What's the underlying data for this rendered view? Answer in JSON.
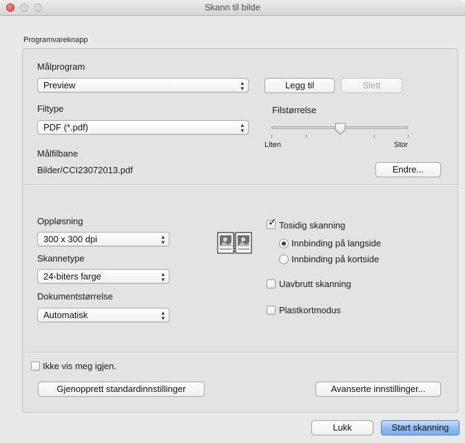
{
  "window": {
    "title": "Skann til bilde"
  },
  "group": {
    "label": "Programvareknapp"
  },
  "app": {
    "target_label": "Målprogram",
    "target_value": "Preview",
    "add_label": "Legg til",
    "delete_label": "Slett",
    "filetype_label": "Filtype",
    "filetype_value": "PDF (*.pdf)",
    "filesize_label": "Filstørrelse",
    "filesize_min": "Liten",
    "filesize_max": "Stor",
    "filesize_level": 0.5,
    "path_label": "Målfilbane",
    "path_value": "Bilder/CCI23072013.pdf",
    "change_label": "Endre..."
  },
  "scan": {
    "resolution_label": "Oppløsning",
    "resolution_value": "300 x 300 dpi",
    "scantype_label": "Skannetype",
    "scantype_value": "24-biters farge",
    "docsize_label": "Dokumentstørrelse",
    "docsize_value": "Automatisk",
    "duplex_label": "Tosidig skanning",
    "duplex_checked": true,
    "binding_long_label": "Innbinding på langside",
    "binding_long_selected": true,
    "binding_short_label": "Innbinding på kortside",
    "continuous_label": "Uavbrutt skanning",
    "plastic_label": "Plastkortmodus"
  },
  "footer": {
    "dont_show_label": "Ikke vis meg igjen.",
    "restore_label": "Gjenopprett standardinnstillinger",
    "advanced_label": "Avanserte innstillinger...",
    "close_label": "Lukk",
    "start_label": "Start skanning"
  }
}
